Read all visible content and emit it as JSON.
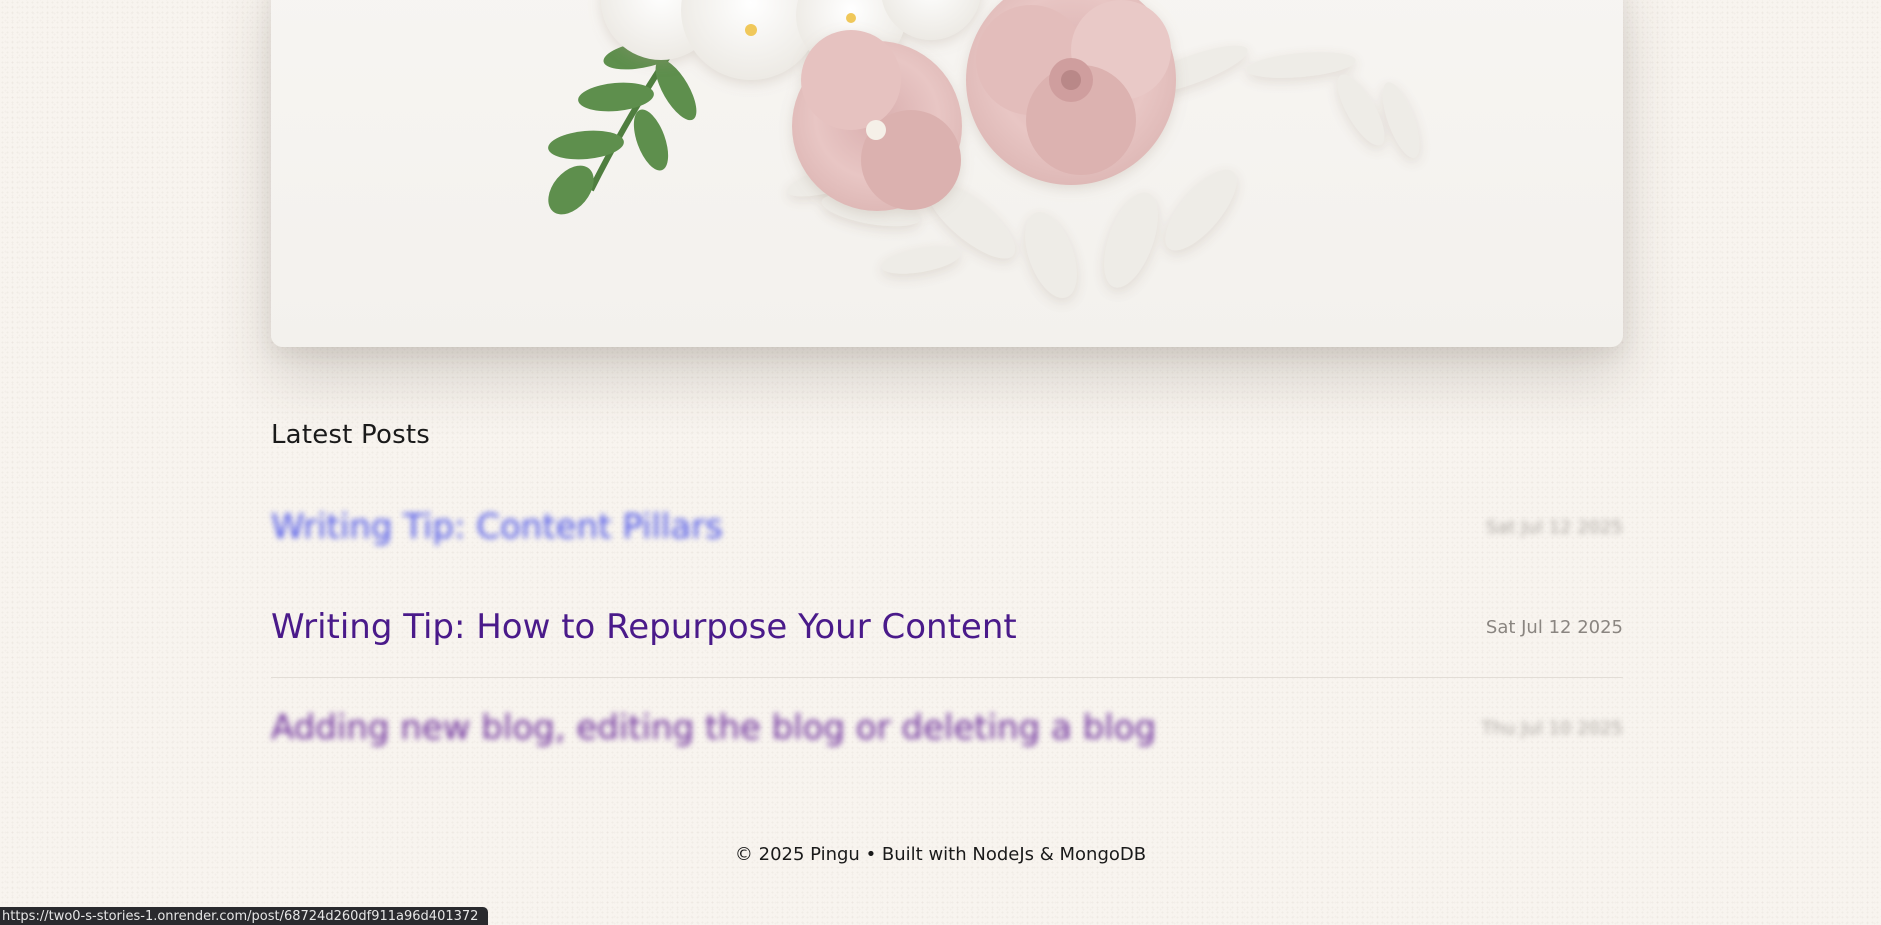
{
  "hero": {
    "image_description": "",
    "colors": {
      "background": "#f5f3ef",
      "rose": "#e8c6c4",
      "white_flower": "#f4f2ee",
      "leaf": "#5e8f4d"
    }
  },
  "latest_posts": {
    "heading": "Latest Posts",
    "items": [
      {
        "title": "Writing Tip: Content Pillars",
        "date": "Sat Jul 12 2025",
        "blurred": true
      },
      {
        "title": "Writing Tip: How to Repurpose Your Content",
        "date": "Sat Jul 12 2025",
        "blurred": false
      },
      {
        "title": "Adding new blog, editing the blog or deleting a blog",
        "date": "Thu Jul 10 2025",
        "blurred": true
      }
    ]
  },
  "footer": {
    "text": "© 2025 Pingu • Built with NodeJs & MongoDB"
  },
  "status_bar": {
    "url": "https://two0-s-stories-1.onrender.com/post/68724d260df911a96d401372"
  },
  "colors": {
    "page_background": "#f8f4ef",
    "post_link": "#4a1a8a",
    "date_text": "#8a8580"
  }
}
